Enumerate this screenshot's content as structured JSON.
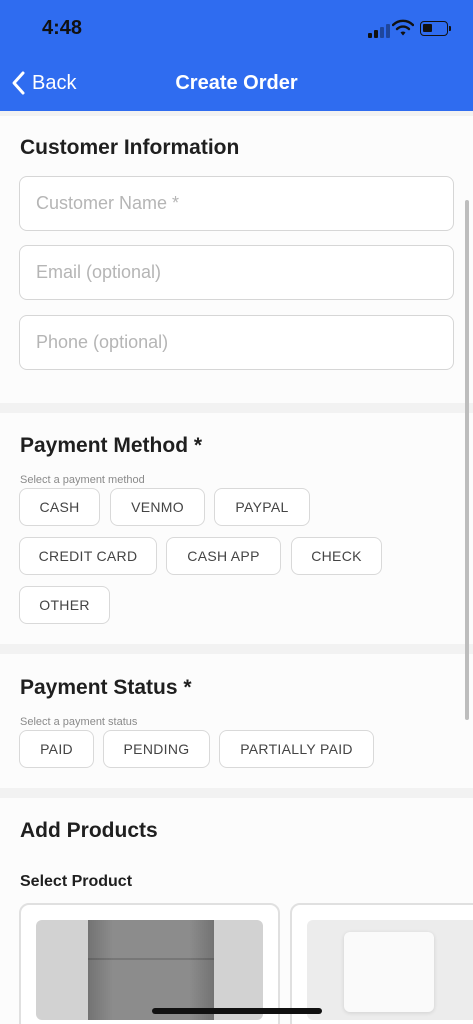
{
  "status_bar": {
    "time": "4:48"
  },
  "nav": {
    "back_label": "Back",
    "title": "Create Order"
  },
  "customer": {
    "heading": "Customer Information",
    "name_placeholder": "Customer Name *",
    "email_placeholder": "Email (optional)",
    "phone_placeholder": "Phone (optional)"
  },
  "payment_method": {
    "heading": "Payment Method *",
    "hint": "Select a payment method",
    "options": [
      "CASH",
      "VENMO",
      "PAYPAL",
      "CREDIT CARD",
      "CASH APP",
      "CHECK",
      "OTHER"
    ]
  },
  "payment_status": {
    "heading": "Payment Status *",
    "hint": "Select a payment status",
    "options": [
      "PAID",
      "PENDING",
      "PARTIALLY PAID"
    ]
  },
  "products": {
    "heading": "Add Products",
    "select_label": "Select Product"
  },
  "colors": {
    "accent": "#2f6cf0",
    "chip_border": "#d9d9d9"
  }
}
